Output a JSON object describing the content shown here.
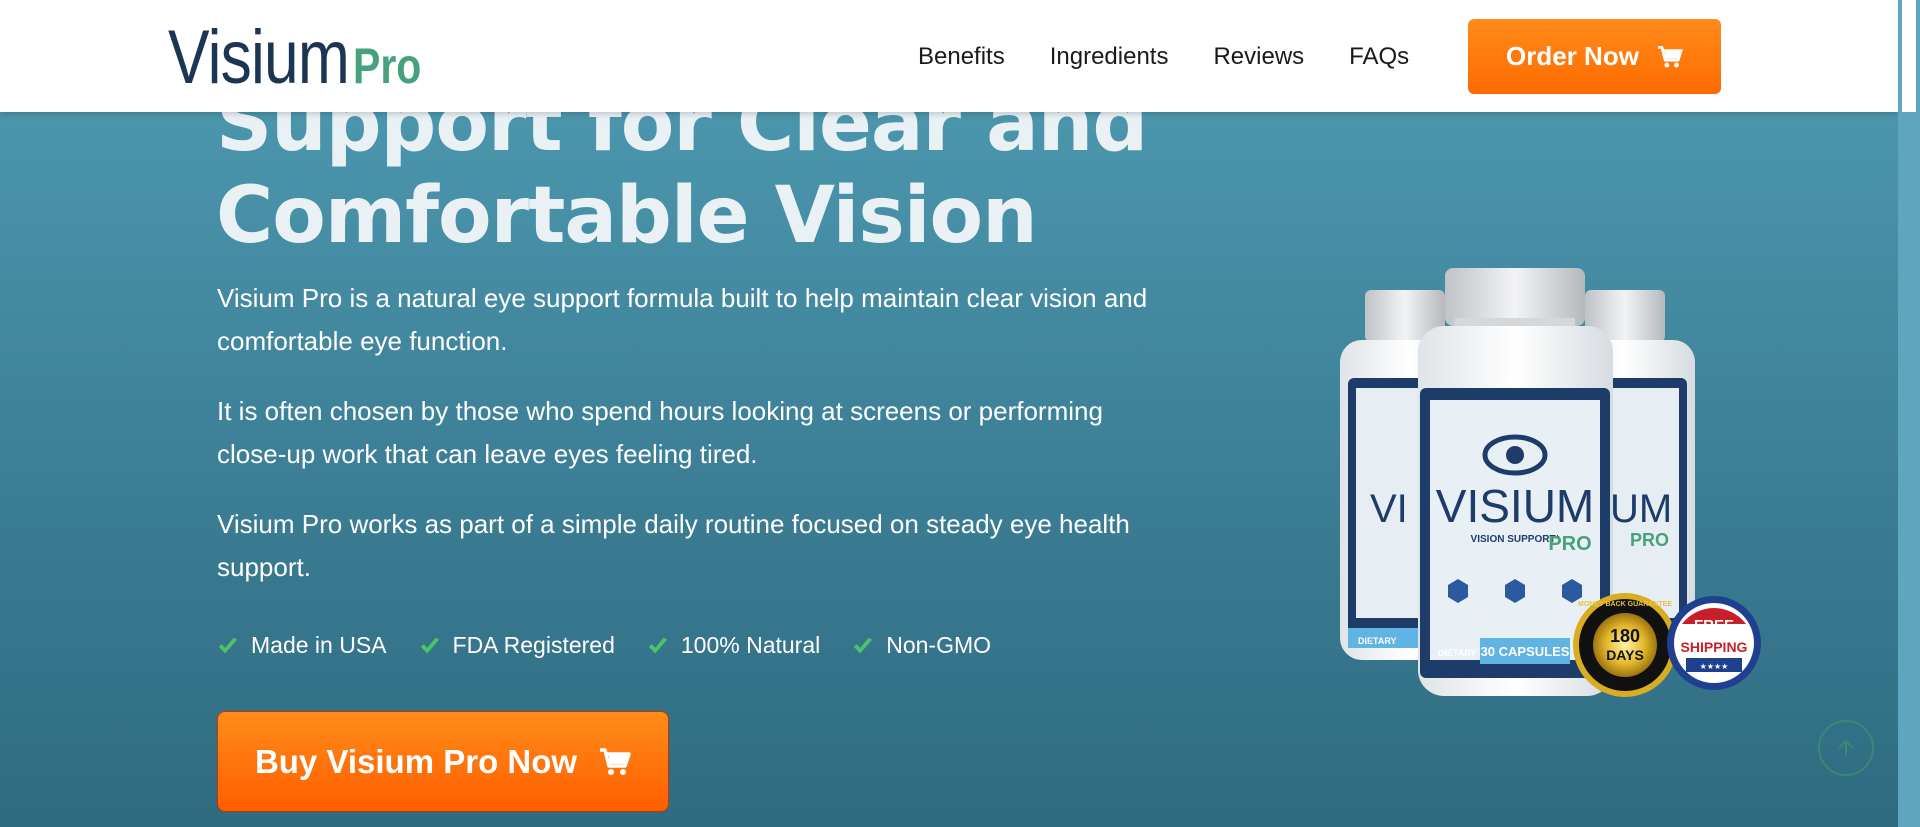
{
  "nav": {
    "logo_main": "Visium",
    "logo_pro": "Pro",
    "links": [
      "Benefits",
      "Ingredients",
      "Reviews",
      "FAQs"
    ],
    "order_label": "Order Now"
  },
  "hero": {
    "headline_line1": "Support for Clear and",
    "headline_line2": "Comfortable Vision",
    "paragraphs": [
      "Visium Pro is a natural eye support formula built to help maintain clear vision and comfortable eye function.",
      "It is often chosen by those who spend hours looking at screens or performing close-up work that can leave eyes feeling tired.",
      "Visium Pro works as part of a simple daily routine focused on steady eye health support."
    ],
    "features": [
      "Made in USA",
      "FDA Registered",
      "100% Natural",
      "Non-GMO"
    ],
    "buy_label": "Buy Visium Pro Now"
  },
  "product": {
    "brand": "VISIUM",
    "brand_pro": "PRO",
    "subtitle": "VISION SUPPORT*",
    "capsules": "30 CAPSULES",
    "dietary": "DIETARY",
    "badge_days_top": "180",
    "badge_days_bottom": "DAYS",
    "badge_ring_text": "MONEY BACK GUARANTEE",
    "badge_free": "FREE",
    "badge_shipping": "SHIPPING"
  },
  "colors": {
    "accent_orange": "#ff7a0d",
    "logo_navy": "#1c3553",
    "logo_green": "#45a27c",
    "check_green": "#4cc36a"
  }
}
